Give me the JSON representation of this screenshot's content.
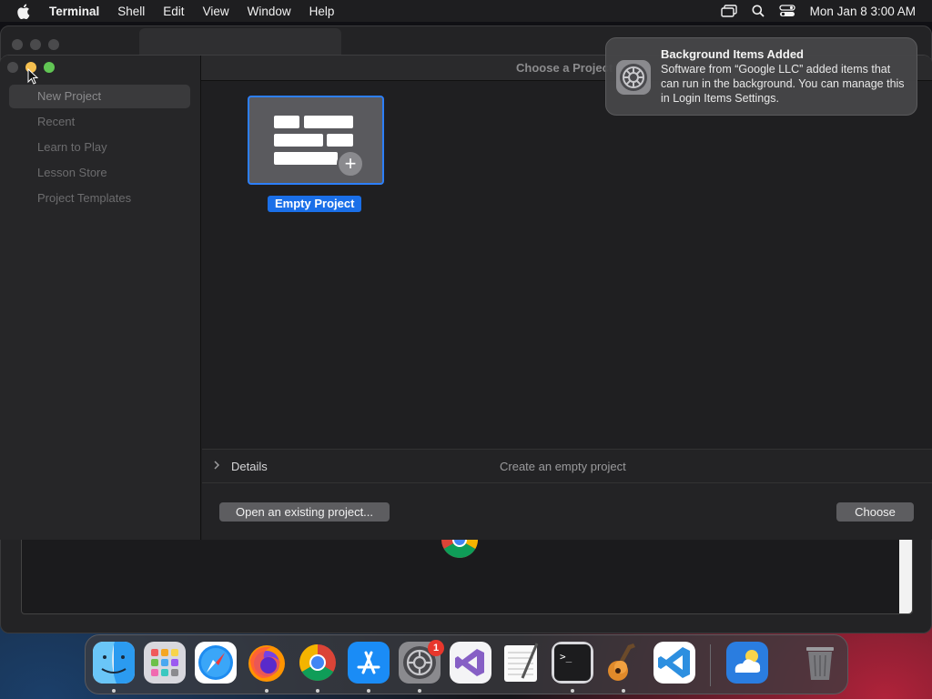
{
  "menubar": {
    "app_name": "Terminal",
    "menus": [
      "Shell",
      "Edit",
      "View",
      "Window",
      "Help"
    ],
    "datetime": "Mon Jan 8  3:00 AM",
    "icons": [
      "apple-icon",
      "screen-mirroring-icon",
      "spotlight-search-icon",
      "control-center-icon"
    ]
  },
  "dialog": {
    "title": "Choose a Project",
    "sidebar": {
      "items": [
        {
          "label": "New Project",
          "selected": true
        },
        {
          "label": "Recent",
          "selected": false
        },
        {
          "label": "Learn to Play",
          "selected": false
        },
        {
          "label": "Lesson Store",
          "selected": false
        },
        {
          "label": "Project Templates",
          "selected": false
        }
      ]
    },
    "template": {
      "label": "Empty Project",
      "selected": true
    },
    "details": {
      "label": "Details",
      "description": "Create an empty project"
    },
    "buttons": {
      "open_existing": "Open an existing project...",
      "choose": "Choose"
    }
  },
  "notification": {
    "title": "Background Items Added",
    "body": "Software from “Google LLC” added items that can run in the background. You can manage this in Login Items Settings.",
    "icon": "system-settings-gear-icon"
  },
  "dock": {
    "apps": [
      {
        "name": "Finder",
        "running": true
      },
      {
        "name": "Launchpad",
        "running": false
      },
      {
        "name": "Safari",
        "running": false
      },
      {
        "name": "Firefox",
        "running": true
      },
      {
        "name": "Google Chrome",
        "running": true
      },
      {
        "name": "App Store",
        "running": true
      },
      {
        "name": "System Settings",
        "running": true,
        "badge": "1"
      },
      {
        "name": "Visual Studio",
        "running": false
      },
      {
        "name": "TextEdit",
        "running": false
      },
      {
        "name": "Terminal",
        "running": true
      },
      {
        "name": "GarageBand",
        "running": true
      },
      {
        "name": "Visual Studio Code",
        "running": false
      },
      {
        "name": "Weather",
        "running": false
      },
      {
        "name": "Trash",
        "running": false
      }
    ]
  },
  "colors": {
    "accent": "#1a6fe8",
    "selection_border": "#2d7ff9",
    "traffic_close": "#4a4a4c",
    "traffic_minimize": "#f5bf4f",
    "traffic_maximize": "#61c554"
  }
}
